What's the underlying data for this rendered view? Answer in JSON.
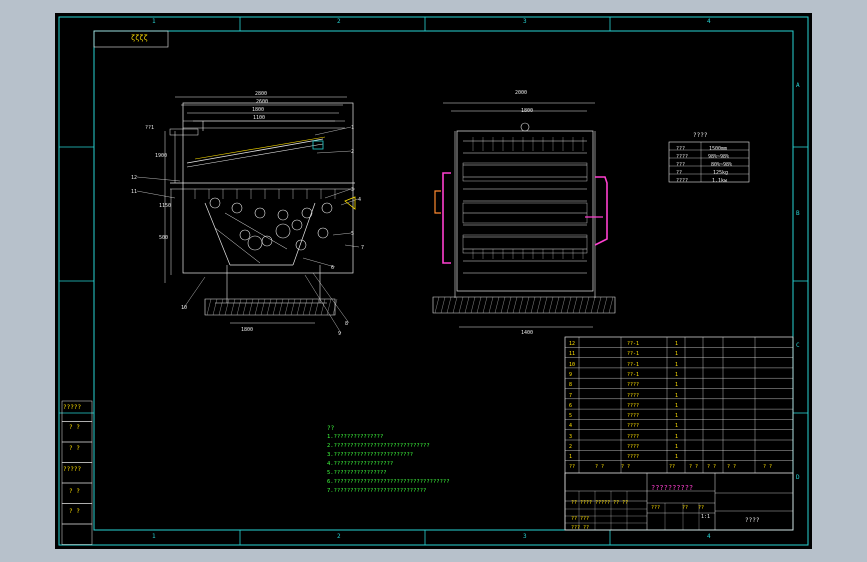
{
  "sheet": {
    "background": "#b7c1cb",
    "paper": "#000000",
    "frame_color": "#27d3d3",
    "zone_numbers_top": [
      "1",
      "2",
      "3",
      "4"
    ],
    "zone_numbers_bottom": [
      "1",
      "2",
      "3",
      "4"
    ],
    "zone_letters_right": [
      "A",
      "B",
      "C",
      "D"
    ]
  },
  "corner_tag": "ζζζζ",
  "left_column_labels": [
    "?????",
    "? ?",
    "? ?",
    "?????",
    "? ?",
    "? ?",
    "? ?"
  ],
  "front_view": {
    "dims_top": [
      "2800",
      "2600",
      "1800",
      "1100"
    ],
    "dims_left": [
      "1900",
      "1150",
      "500"
    ],
    "dim_bottom": "1800",
    "left_callout": "??1",
    "part_numbers": [
      "1",
      "2",
      "3",
      "4",
      "5",
      "6",
      "7",
      "8",
      "9",
      "10",
      "11",
      "12"
    ]
  },
  "side_view": {
    "dims_top": [
      "2000",
      "1800"
    ],
    "dim_bottom": "1400"
  },
  "specs_table": {
    "heading": "????",
    "rows": [
      [
        "???",
        "1500mm"
      ],
      [
        "????",
        "98%~98%"
      ],
      [
        "???",
        "80%~98%"
      ],
      [
        "??",
        "125kg"
      ],
      [
        "????",
        "1.1kw"
      ]
    ]
  },
  "notes": {
    "heading": "??",
    "lines": [
      "1.???????????????",
      "2.?????????????????????????????",
      "3.????????????????????????",
      "4.??????????????????",
      "5.????????????????",
      "6.???????????????????????????????????",
      "7.????????????????????????????"
    ]
  },
  "parts_list": {
    "rows": [
      [
        "12",
        "",
        "??-1",
        "1"
      ],
      [
        "11",
        "",
        "??-1",
        "1"
      ],
      [
        "10",
        "",
        "??-1",
        "1"
      ],
      [
        "9",
        "",
        "??-1",
        "1"
      ],
      [
        "8",
        "",
        "????",
        "1"
      ],
      [
        "7",
        "",
        "????",
        "1"
      ],
      [
        "6",
        "",
        "????",
        "1"
      ],
      [
        "5",
        "",
        "????",
        "1"
      ],
      [
        "4",
        "",
        "????",
        "1"
      ],
      [
        "3",
        "",
        "????",
        "1"
      ],
      [
        "2",
        "",
        "????",
        "1"
      ],
      [
        "1",
        "",
        "????",
        "1"
      ]
    ],
    "header": [
      "??",
      "?  ?",
      "?  ?",
      "??",
      "?  ?",
      "?  ?",
      "? ?",
      "?  ?"
    ]
  },
  "title_block": {
    "drawing_title": "??????????",
    "company": "????",
    "rows": [
      "?? ???? ????? ?? ??",
      "?? ???",
      "??? ??"
    ],
    "scale_labels": [
      "???",
      "??",
      "??"
    ],
    "scale_value": "1:1"
  }
}
